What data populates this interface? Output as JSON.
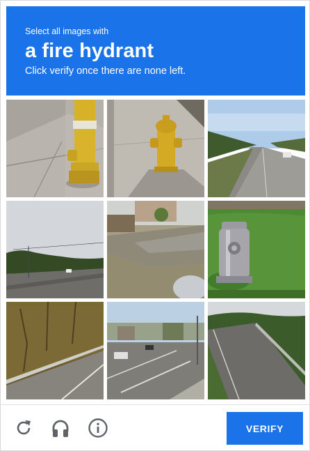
{
  "challenge": {
    "instruction_small": "Select all images with",
    "target_object": "a fire hydrant",
    "instruction_note": "Click verify once there are none left."
  },
  "tiles": [
    {
      "index": 1,
      "content": "yellow fire hydrant on sidewalk"
    },
    {
      "index": 2,
      "content": "yellow fire hydrant on sidewalk"
    },
    {
      "index": 3,
      "content": "street road"
    },
    {
      "index": 4,
      "content": "road with trees"
    },
    {
      "index": 5,
      "content": "street corner"
    },
    {
      "index": 6,
      "content": "silver fire hydrant in grass"
    },
    {
      "index": 7,
      "content": "road with guardrail"
    },
    {
      "index": 8,
      "content": "city intersection"
    },
    {
      "index": 9,
      "content": "highway with guardrail"
    }
  ],
  "footer": {
    "reload_icon": "reload-icon",
    "audio_icon": "headphones-icon",
    "info_icon": "info-icon",
    "verify_label": "VERIFY"
  },
  "colors": {
    "brand_blue": "#1a73e8",
    "footer_icon": "#5f6368"
  }
}
